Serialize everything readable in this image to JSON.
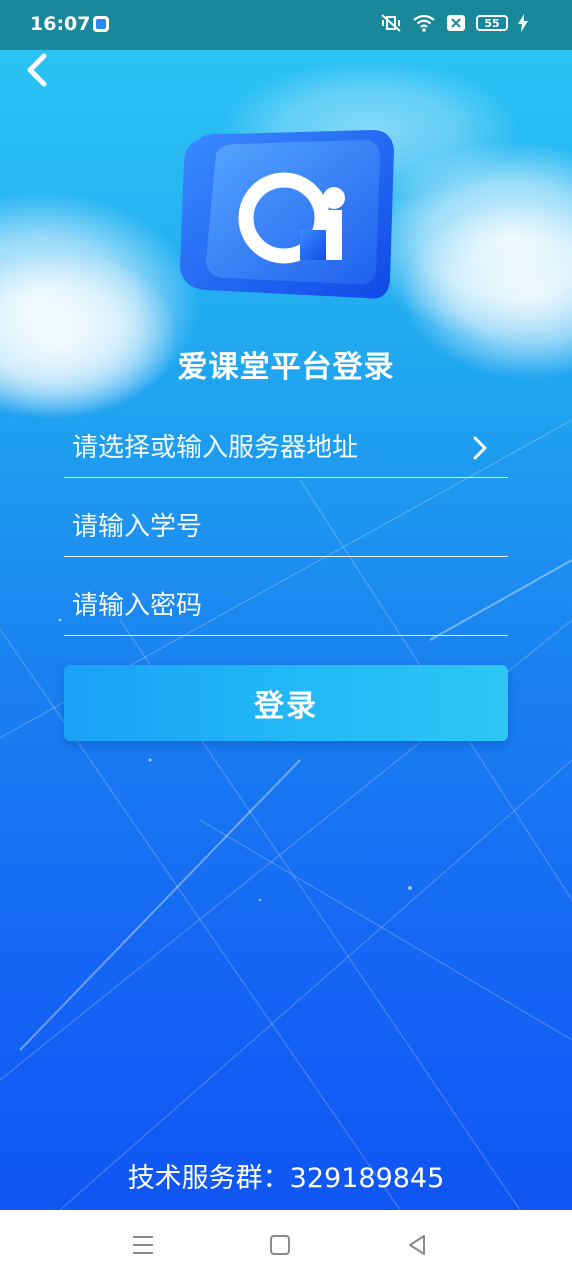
{
  "status_bar": {
    "time": "16:07",
    "battery_level": "55"
  },
  "login": {
    "title": "爱课堂平台登录",
    "server_placeholder": "请选择或输入服务器地址",
    "student_id_placeholder": "请输入学号",
    "password_placeholder": "请输入密码",
    "login_label": "登录"
  },
  "footer": {
    "support_text": "技术服务群：329189845"
  },
  "icons": {
    "back": "chevron-left-icon",
    "server_select": "chevron-right-icon",
    "logo": "ai-logo-icon",
    "nav_menu": "menu-icon",
    "nav_home": "square-home-icon",
    "nav_back": "triangle-back-icon"
  },
  "colors": {
    "status_bar": "#19889a",
    "gradient_top": "#2ec7f5",
    "gradient_bottom": "#0f55f3",
    "button": "#22b7f6",
    "text": "#ffffff"
  }
}
